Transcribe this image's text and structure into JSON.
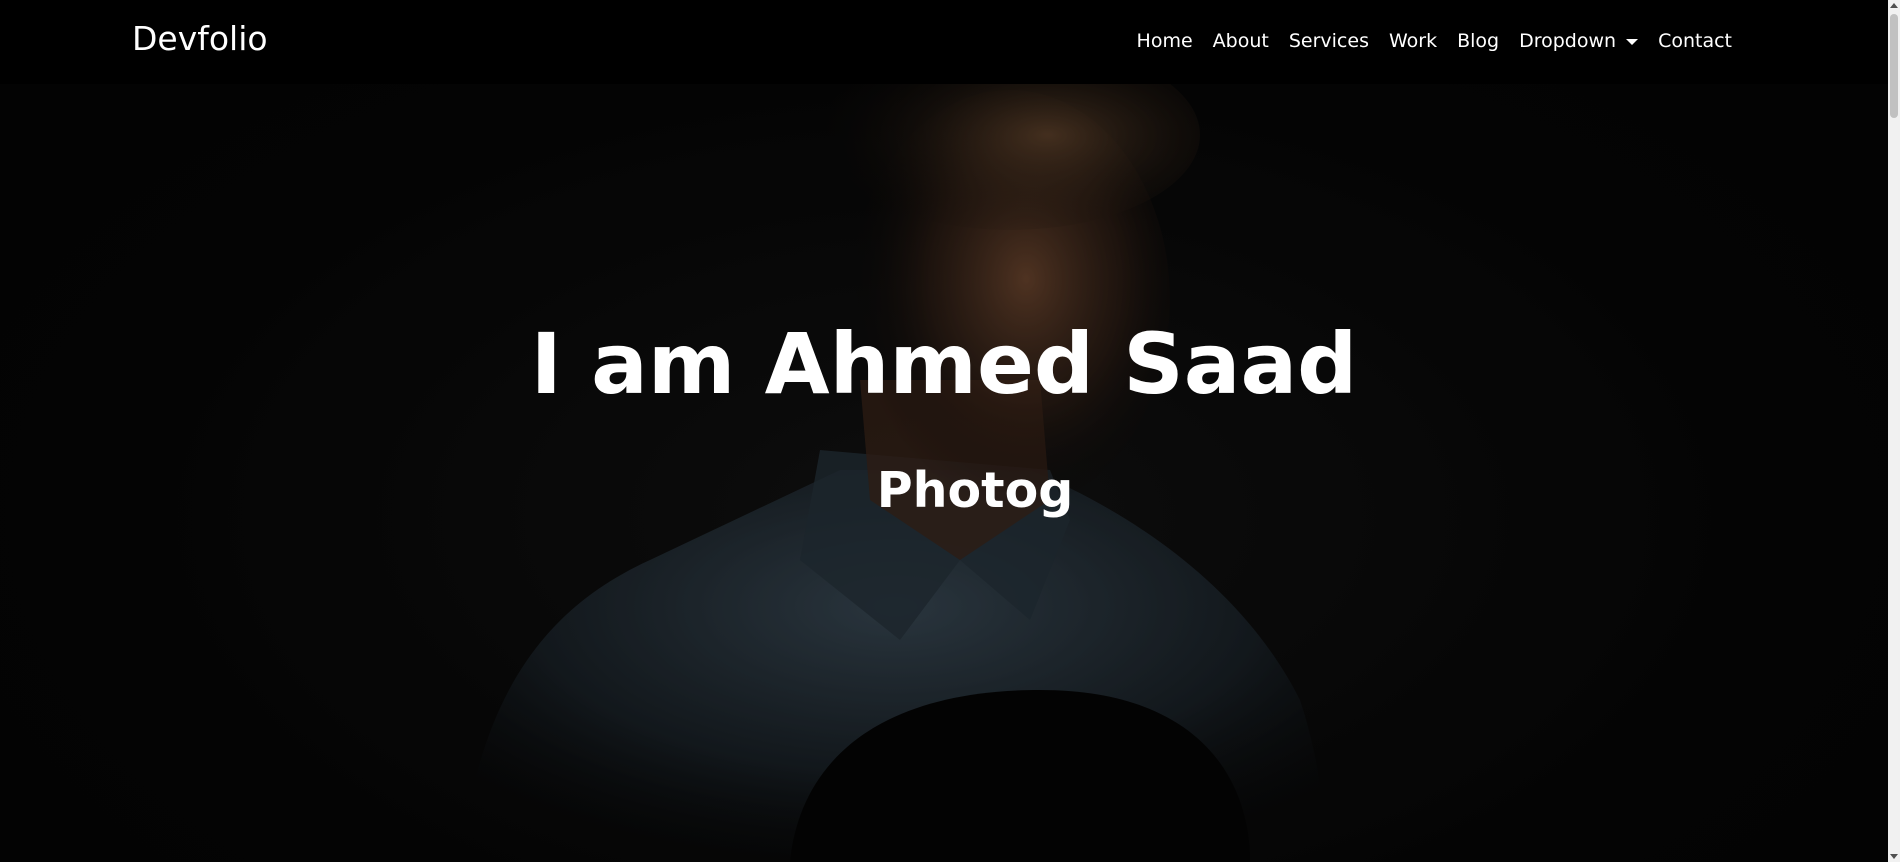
{
  "navbar": {
    "brand": "Devfolio",
    "links": [
      {
        "label": "Home"
      },
      {
        "label": "About"
      },
      {
        "label": "Services"
      },
      {
        "label": "Work"
      },
      {
        "label": "Blog"
      },
      {
        "label": "Dropdown",
        "has_caret": true
      },
      {
        "label": "Contact"
      }
    ]
  },
  "hero": {
    "title": "I am Ahmed Saad",
    "subtitle": "Photog"
  },
  "colors": {
    "navbar_bg": "#000000",
    "text": "#ffffff",
    "hero_bg": "#070707",
    "shirt": "#2e3a44",
    "skin_highlight": "#8a5a3c"
  },
  "icons": {
    "dropdown": "caret-down-icon",
    "scroll_up": "arrow-up-icon",
    "scroll_down": "arrow-down-icon"
  }
}
